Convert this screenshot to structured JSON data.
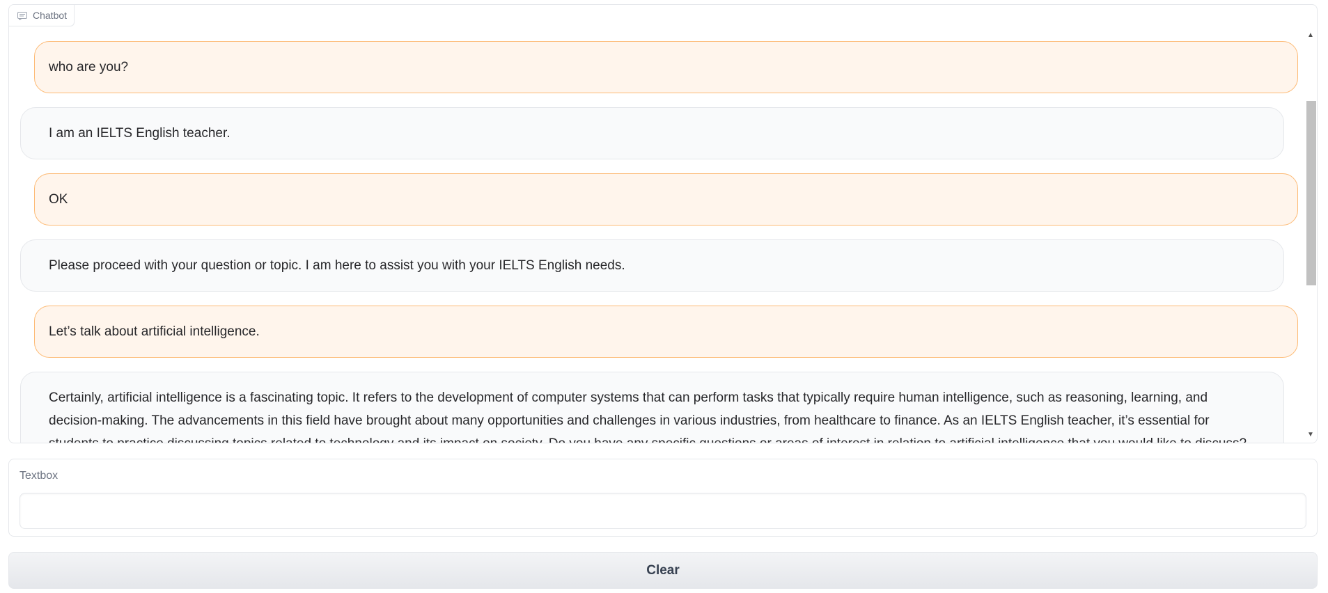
{
  "chatbot": {
    "label": "Chatbot",
    "label_icon": "chat-icon",
    "messages": [
      {
        "role": "user",
        "text": "who are you?"
      },
      {
        "role": "bot",
        "text": "I am an IELTS English teacher."
      },
      {
        "role": "user",
        "text": "OK"
      },
      {
        "role": "bot",
        "text": "Please proceed with your question or topic. I am here to assist you with your IELTS English needs."
      },
      {
        "role": "user",
        "text": "Let’s talk about artificial intelligence."
      },
      {
        "role": "bot",
        "text": "Certainly, artificial intelligence is a fascinating topic. It refers to the development of computer systems that can perform tasks that typically require human intelligence, such as reasoning, learning, and decision-making. The advancements in this field have brought about many opportunities and challenges in various industries, from healthcare to finance. As an IELTS English teacher, it’s essential for students to practice discussing topics related to technology and its impact on society. Do you have any specific questions or areas of interest in relation to artificial intelligence that you would like to discuss?"
      }
    ]
  },
  "textbox": {
    "label": "Textbox",
    "value": "",
    "placeholder": ""
  },
  "clear_button": {
    "label": "Clear"
  },
  "colors": {
    "user_bubble_bg": "#fff5ec",
    "user_bubble_border": "#fdba74",
    "bot_bubble_bg": "#f9fafb",
    "bot_bubble_border": "#e5e7eb"
  }
}
